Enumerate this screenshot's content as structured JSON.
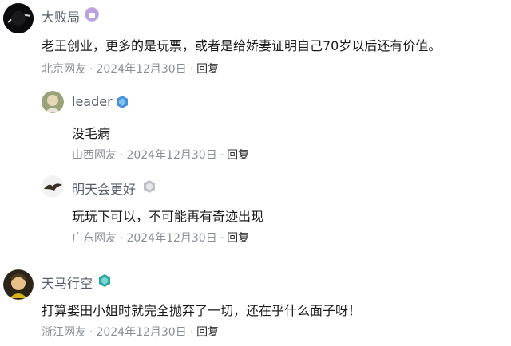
{
  "comments": [
    {
      "username": "大败局",
      "content": "老王创业，更多的是玩票，或者是给娇妻证明自己70岁以后还有价值。",
      "location": "北京网友",
      "date": "2024年12月30日",
      "reply_label": "回复",
      "avatar_icon": "dark-planet-avatar",
      "badge_icon": "purple-level-badge-icon"
    },
    {
      "username": "leader",
      "content": "没毛病",
      "location": "山西网友",
      "date": "2024年12月30日",
      "reply_label": "回复",
      "avatar_icon": "elder-portrait-avatar",
      "badge_icon": "blue-level-badge-icon"
    },
    {
      "username": "明天会更好",
      "content": "玩玩下可以，不可能再有奇迹出现",
      "location": "广东网友",
      "date": "2024年12月30日",
      "reply_label": "回复",
      "avatar_icon": "eagle-avatar",
      "badge_icon": "gray-level-badge-icon"
    },
    {
      "username": "天马行空",
      "content": "打算娶田小姐时就完全抛弃了一切，还在乎什么面子呀！",
      "location": "浙江网友",
      "date": "2024年12月30日",
      "reply_label": "回复",
      "avatar_icon": "cartoon-character-avatar",
      "badge_icon": "teal-level-badge-icon"
    }
  ],
  "separator": "·"
}
